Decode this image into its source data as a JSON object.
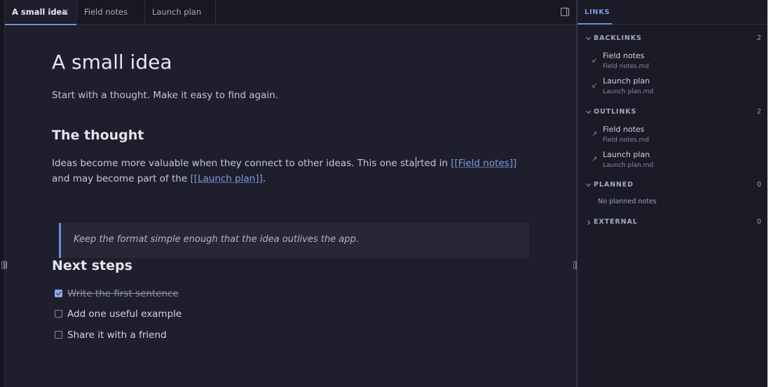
{
  "tabs": [
    {
      "label": "A small idea",
      "active": true,
      "close": "×"
    },
    {
      "label": "Field notes",
      "active": false
    },
    {
      "label": "Launch plan",
      "active": false
    }
  ],
  "document": {
    "title": "A small idea",
    "intro": "Start with a thought. Make it easy to find again.",
    "section1_heading": "The thought",
    "para_before_caret": "Ideas become more valuable when they connect to other ideas. This one sta",
    "para_after_caret": "rted in ",
    "link_field_notes": "[[Field notes]]",
    "para_middle": " and may become part of the ",
    "link_launch_plan": "[[Launch plan]]",
    "para_end": ".",
    "quote": "Keep the format simple enough that the idea outlives the app.",
    "section2_heading": "Next steps",
    "tasks": [
      {
        "text": "Write the first sentence",
        "checked": true
      },
      {
        "text": "Add one useful example",
        "checked": false
      },
      {
        "text": "Share it with a friend",
        "checked": false
      }
    ]
  },
  "panel": {
    "tab_label": "LINKS",
    "backlinks": {
      "label": "BACKLINKS",
      "count": "2",
      "items": [
        {
          "title": "Field notes",
          "file": "Field notes.md",
          "arrow": "↙"
        },
        {
          "title": "Launch plan",
          "file": "Launch plan.md",
          "arrow": "↙"
        }
      ]
    },
    "outlinks": {
      "label": "OUTLINKS",
      "count": "2",
      "items": [
        {
          "title": "Field notes",
          "file": "Field notes.md",
          "arrow": "↗"
        },
        {
          "title": "Launch plan",
          "file": "Launch plan.md",
          "arrow": "↗"
        }
      ]
    },
    "planned": {
      "label": "PLANNED",
      "count": "0",
      "empty_text": "No planned notes"
    },
    "external": {
      "label": "EXTERNAL",
      "count": "0"
    }
  },
  "colors": {
    "accent": "#6c8fd8",
    "link": "#7f9de0",
    "background": "#1e1e2c",
    "panel_background": "#1b1b28",
    "checkbox_checked": "#8fa9ec"
  }
}
